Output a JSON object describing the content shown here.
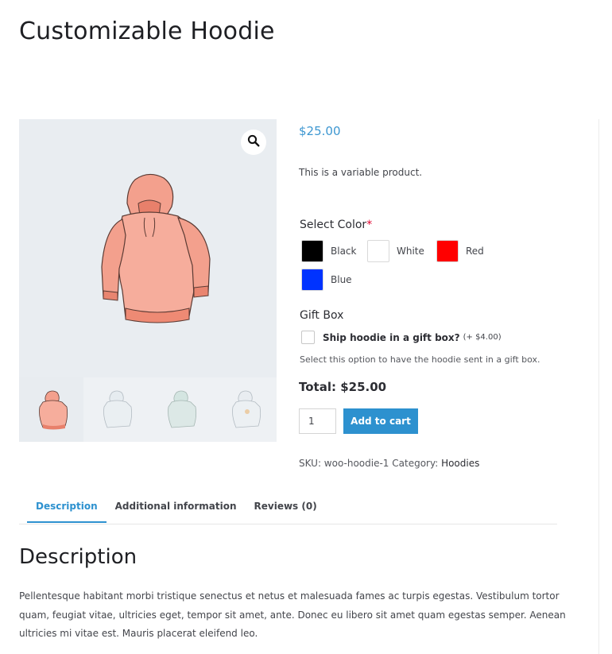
{
  "product": {
    "title": "Customizable Hoodie",
    "price": "$25.00",
    "short_description": "This is a variable product."
  },
  "gallery": {
    "zoom_icon": "magnifier-icon",
    "thumbnails": [
      "hoodie-pink",
      "hoodie-white",
      "hoodie-green",
      "hoodie-white-logo"
    ]
  },
  "color_field": {
    "label": "Select Color",
    "required_mark": "*",
    "options": [
      {
        "name": "Black",
        "color": "#000000"
      },
      {
        "name": "White",
        "color": "#ffffff"
      },
      {
        "name": "Red",
        "color": "#ff0000"
      },
      {
        "name": "Blue",
        "color": "#0033ff"
      }
    ]
  },
  "gift_box": {
    "label": "Gift Box",
    "option_label": "Ship hoodie in a gift box?",
    "option_price": "(+ $4.00)",
    "help_text": "Select this option to have the hoodie sent in a gift box."
  },
  "total": "Total: $25.00",
  "cart": {
    "quantity": "1",
    "add_to_cart_label": "Add to cart"
  },
  "meta": {
    "sku_text": "SKU: woo-hoodie-1 Category: ",
    "category": "Hoodies"
  },
  "tabs": [
    {
      "label": "Description",
      "active": true
    },
    {
      "label": "Additional information",
      "active": false
    },
    {
      "label": "Reviews (0)",
      "active": false
    }
  ],
  "description": {
    "heading": "Description",
    "body": "Pellentesque habitant morbi tristique senectus et netus et malesuada fames ac turpis egestas. Vestibulum tortor quam, feugiat vitae, ultricies eget, tempor sit amet, ante. Donec eu libero sit amet quam egestas semper. Aenean ultricies mi vitae est. Mauris placerat eleifend leo."
  },
  "colors": {
    "accent": "#2d91cf",
    "price": "#3d97d1",
    "hoodie_pink": "#f4a593",
    "hoodie_white": "#dde6ec",
    "hoodie_green": "#c8ded6"
  }
}
